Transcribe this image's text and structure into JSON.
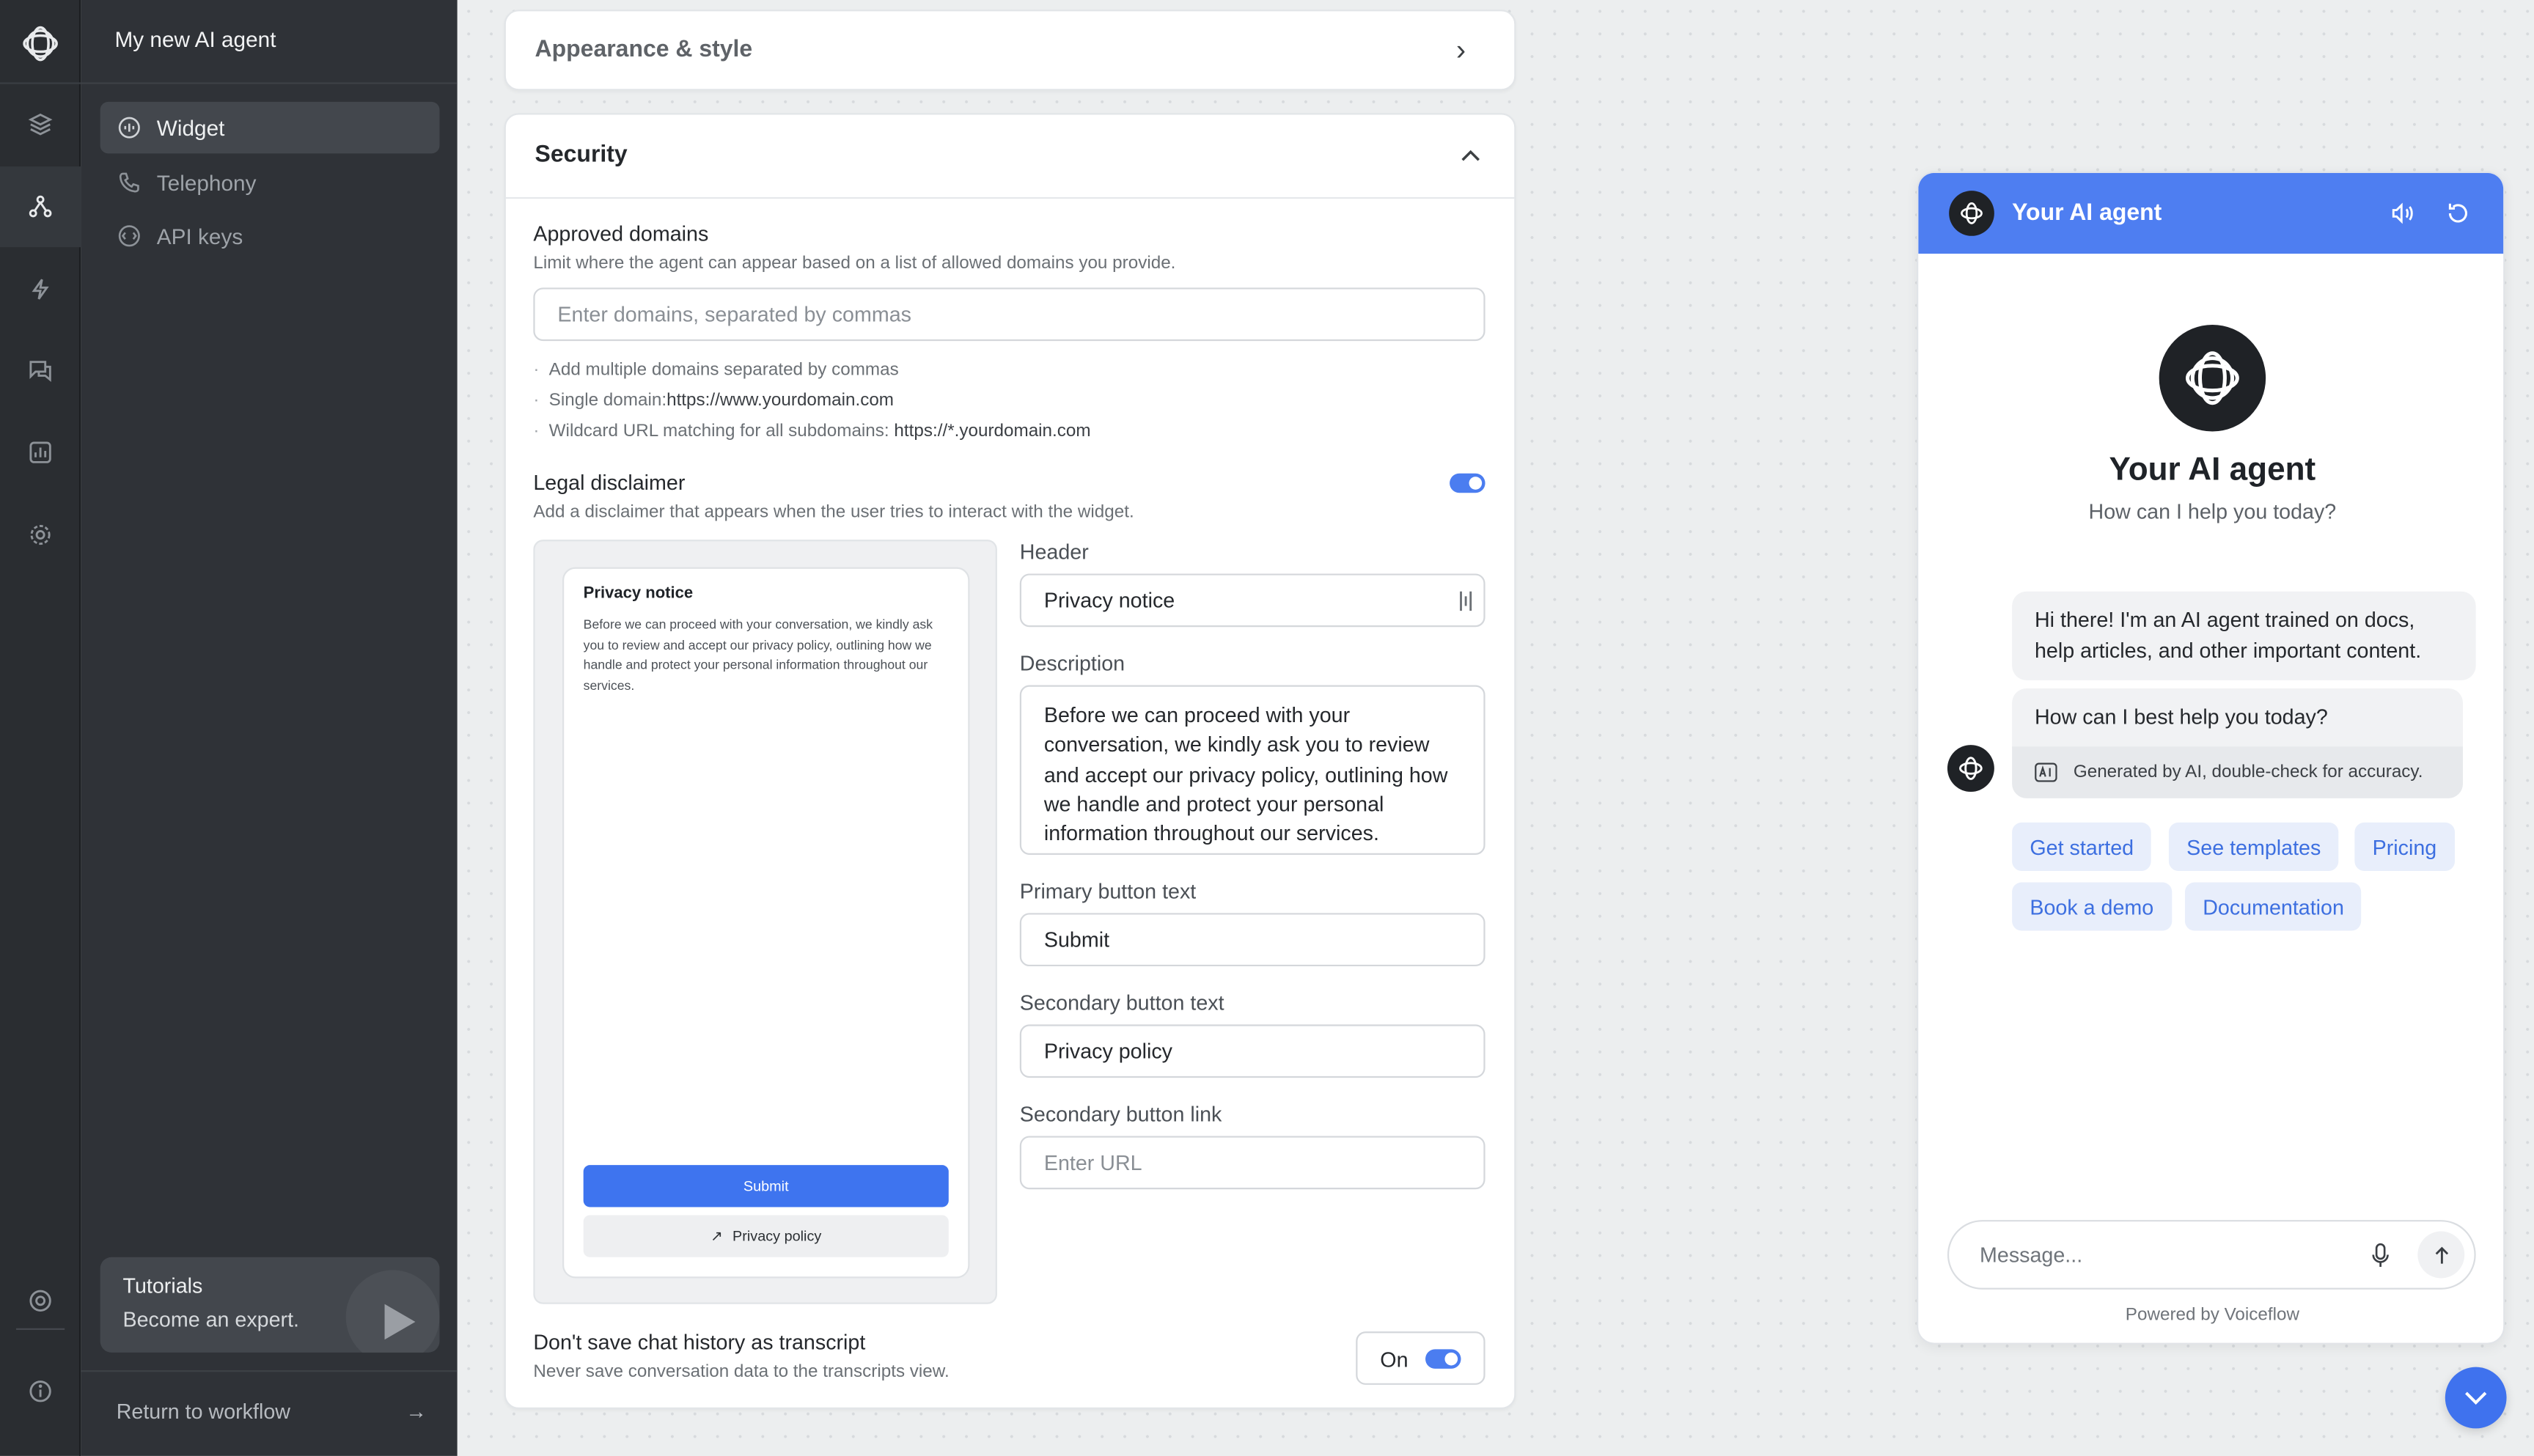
{
  "sidebar": {
    "title": "My new AI agent",
    "items": [
      {
        "label": "Widget",
        "icon": "widget-icon"
      },
      {
        "label": "Telephony",
        "icon": "phone-icon"
      },
      {
        "label": "API keys",
        "icon": "key-icon"
      }
    ],
    "tutorials": {
      "title": "Tutorials",
      "subtitle": "Become an expert."
    },
    "return_label": "Return to workflow",
    "return_arrow": "→"
  },
  "appearance": {
    "title": "Appearance & style",
    "chevron": "›"
  },
  "security": {
    "title": "Security",
    "approved_domains": {
      "label": "Approved domains",
      "description": "Limit where the agent can appear based on a list of allowed domains you provide.",
      "placeholder": "Enter domains, separated by commas",
      "hints": [
        {
          "text": "Add multiple domains separated by commas",
          "code": ""
        },
        {
          "text": "Single domain:",
          "code": "https://www.yourdomain.com"
        },
        {
          "text": "Wildcard URL matching for all subdomains: ",
          "code": "https://*.yourdomain.com"
        }
      ]
    },
    "legal": {
      "label": "Legal disclaimer",
      "description": "Add a disclaimer that appears when the user tries to interact with the widget.",
      "enabled": true,
      "preview": {
        "title": "Privacy notice",
        "text": "Before we can proceed with your conversation, we kindly ask you to review and accept our privacy policy, outlining how we handle and protect your personal information throughout our services.",
        "submit": "Submit",
        "secondary": "Privacy policy",
        "secondary_icon": "↗"
      },
      "header_label": "Header",
      "header_value": "Privacy notice",
      "description_label": "Description",
      "description_value": "Before we can proceed with your conversation, we kindly ask you to review and accept our privacy policy, outlining how we handle and protect your personal information throughout our services.",
      "primary_label": "Primary button text",
      "primary_value": "Submit",
      "secondary_label": "Secondary button text",
      "secondary_value": "Privacy policy",
      "link_label": "Secondary button link",
      "link_placeholder": "Enter URL"
    },
    "transcript": {
      "label": "Don't save chat history as transcript",
      "description": "Never save conversation data to the transcripts view.",
      "state": "On"
    }
  },
  "chat": {
    "header_title": "Your AI agent",
    "name": "Your AI agent",
    "tagline": "How can I help you today?",
    "messages": [
      "Hi there! I'm an AI agent trained on docs, help articles, and other important content.",
      "How can I best help you today?"
    ],
    "ai_note": "Generated by AI, double-check for accuracy.",
    "chips": [
      "Get started",
      "See templates",
      "Pricing",
      "Book a demo",
      "Documentation"
    ],
    "input_placeholder": "Message...",
    "powered_by": "Powered by Voiceflow"
  },
  "colors": {
    "accent": "#4e7ef1",
    "sidebar": "#2f3237",
    "rail": "#2a2d31"
  }
}
